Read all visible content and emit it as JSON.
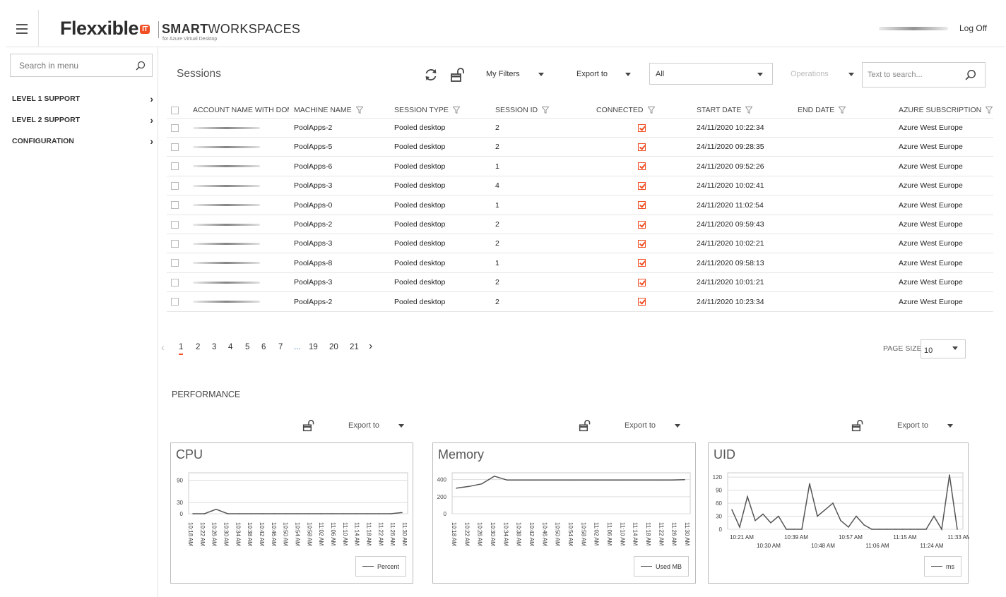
{
  "header": {
    "logo_text": "Flexxible",
    "logo_badge": "IT",
    "brand_bold": "SMART",
    "brand_light": "WORKSPACES",
    "brand_sub": "for Azure Virtual Desktop",
    "logoff": "Log Off"
  },
  "sidebar": {
    "search_placeholder": "Search in menu",
    "items": [
      {
        "label": "LEVEL 1 SUPPORT"
      },
      {
        "label": "LEVEL 2 SUPPORT"
      },
      {
        "label": "CONFIGURATION"
      }
    ]
  },
  "toolbar": {
    "title": "Sessions",
    "my_filters": "My Filters",
    "export_to": "Export to",
    "select_value": "All",
    "operations": "Operations",
    "search_placeholder": "Text to search..."
  },
  "table": {
    "columns": [
      "ACCOUNT NAME WITH DOM",
      "MACHINE NAME",
      "SESSION TYPE",
      "SESSION ID",
      "CONNECTED",
      "START DATE",
      "END DATE",
      "AZURE SUBSCRIPTION"
    ],
    "rows": [
      {
        "machine": "PoolApps-2",
        "type": "Pooled desktop",
        "id": "2",
        "connected": true,
        "start": "24/11/2020 10:22:34",
        "end": "",
        "sub": "Azure West Europe"
      },
      {
        "machine": "PoolApps-5",
        "type": "Pooled desktop",
        "id": "2",
        "connected": true,
        "start": "24/11/2020 09:28:35",
        "end": "",
        "sub": "Azure West Europe"
      },
      {
        "machine": "PoolApps-6",
        "type": "Pooled desktop",
        "id": "1",
        "connected": true,
        "start": "24/11/2020 09:52:26",
        "end": "",
        "sub": "Azure West Europe"
      },
      {
        "machine": "PoolApps-3",
        "type": "Pooled desktop",
        "id": "4",
        "connected": true,
        "start": "24/11/2020 10:02:41",
        "end": "",
        "sub": "Azure West Europe"
      },
      {
        "machine": "PoolApps-0",
        "type": "Pooled desktop",
        "id": "1",
        "connected": true,
        "start": "24/11/2020 11:02:54",
        "end": "",
        "sub": "Azure West Europe"
      },
      {
        "machine": "PoolApps-2",
        "type": "Pooled desktop",
        "id": "2",
        "connected": true,
        "start": "24/11/2020 09:59:43",
        "end": "",
        "sub": "Azure West Europe"
      },
      {
        "machine": "PoolApps-3",
        "type": "Pooled desktop",
        "id": "2",
        "connected": true,
        "start": "24/11/2020 10:02:21",
        "end": "",
        "sub": "Azure West Europe"
      },
      {
        "machine": "PoolApps-8",
        "type": "Pooled desktop",
        "id": "1",
        "connected": true,
        "start": "24/11/2020 09:58:13",
        "end": "",
        "sub": "Azure West Europe"
      },
      {
        "machine": "PoolApps-3",
        "type": "Pooled desktop",
        "id": "2",
        "connected": true,
        "start": "24/11/2020 10:01:21",
        "end": "",
        "sub": "Azure West Europe"
      },
      {
        "machine": "PoolApps-2",
        "type": "Pooled desktop",
        "id": "2",
        "connected": true,
        "start": "24/11/2020 10:23:34",
        "end": "",
        "sub": "Azure West Europe"
      }
    ]
  },
  "pagination": {
    "pages": [
      "1",
      "2",
      "3",
      "4",
      "5",
      "6",
      "7",
      "...",
      "19",
      "20",
      "21"
    ],
    "active": "1",
    "page_size_label": "PAGE SIZE",
    "page_size": "10"
  },
  "performance": {
    "title": "PERFORMANCE",
    "export_to": "Export to"
  },
  "colors": {
    "accent": "#f04e23",
    "line": "#555555"
  },
  "icons": [
    "hamburger-icon",
    "search-icon",
    "refresh-icon",
    "unlock-icon",
    "filter-icon",
    "chevron-right-icon",
    "chevron-left-icon"
  ],
  "chart_data": [
    {
      "type": "line",
      "title": "CPU",
      "yticks": [
        0,
        30,
        90
      ],
      "ylim": [
        0,
        110
      ],
      "x": [
        "10:18 AM",
        "10:22 AM",
        "10:26 AM",
        "10:30 AM",
        "10:34 AM",
        "10:38 AM",
        "10:42 AM",
        "10:46 AM",
        "10:50 AM",
        "10:54 AM",
        "10:58 AM",
        "11:02 AM",
        "11:06 AM",
        "11:10 AM",
        "11:14 AM",
        "11:18 AM",
        "11:22 AM",
        "11:26 AM",
        "11:30 AM"
      ],
      "series": [
        {
          "name": "Percent",
          "values": [
            0,
            0,
            12,
            0,
            0,
            0,
            0,
            0,
            0,
            0,
            0,
            0,
            0,
            0,
            0,
            0,
            0,
            0,
            3
          ]
        }
      ]
    },
    {
      "type": "line",
      "title": "Memory",
      "yticks": [
        0,
        200,
        400
      ],
      "ylim": [
        0,
        480
      ],
      "x": [
        "10:18 AM",
        "10:22 AM",
        "10:26 AM",
        "10:30 AM",
        "10:34 AM",
        "10:38 AM",
        "10:42 AM",
        "10:46 AM",
        "10:50 AM",
        "10:54 AM",
        "10:58 AM",
        "11:02 AM",
        "11:06 AM",
        "11:10 AM",
        "11:14 AM",
        "11:18 AM",
        "11:22 AM",
        "11:26 AM",
        "11:30 AM"
      ],
      "series": [
        {
          "name": "Used MB",
          "values": [
            300,
            320,
            350,
            440,
            395,
            395,
            395,
            395,
            395,
            395,
            395,
            395,
            395,
            395,
            395,
            395,
            395,
            395,
            400
          ]
        }
      ]
    },
    {
      "type": "line",
      "title": "UID",
      "yticks": [
        0,
        30,
        60,
        90,
        120
      ],
      "ylim": [
        0,
        130
      ],
      "xticks_top": [
        "10:21 AM",
        "10:39 AM",
        "10:57 AM",
        "11:15 AM",
        "11:33 AM"
      ],
      "xticks_bottom": [
        "10:30 AM",
        "10:48 AM",
        "11:06 AM",
        "11:24 AM"
      ],
      "series": [
        {
          "name": "ms",
          "values": [
            45,
            5,
            75,
            20,
            35,
            15,
            30,
            0,
            0,
            0,
            105,
            30,
            45,
            60,
            20,
            5,
            30,
            10,
            0,
            0,
            0,
            0,
            0,
            0,
            0,
            0,
            30,
            0,
            125,
            0
          ]
        }
      ]
    }
  ]
}
